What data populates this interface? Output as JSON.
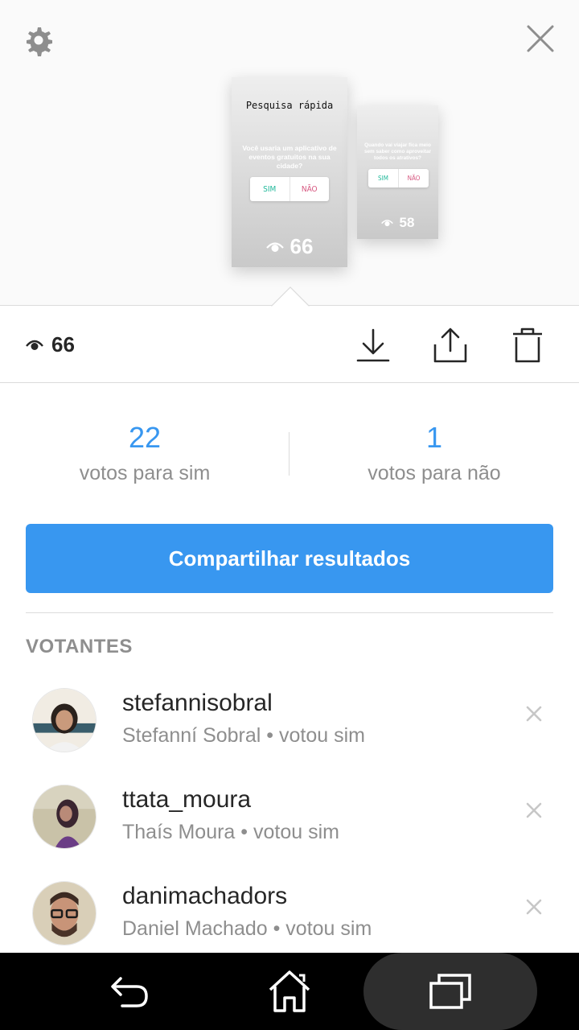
{
  "preview": {
    "settings_icon": "gear-icon",
    "close_icon": "close-icon",
    "stories": [
      {
        "title": "Pesquisa rápida",
        "question": "Você usaria um aplicativo de eventos gratuitos na sua cidade?",
        "option_yes": "SIM",
        "option_no": "NÃO",
        "views": "66"
      },
      {
        "title": "",
        "question": "Quando vai viajar fica meio sem saber como aproveitar todos os atrativos?",
        "option_yes": "SIM",
        "option_no": "NÃO",
        "views": "58"
      }
    ]
  },
  "toolbar": {
    "views": "66",
    "download_icon": "download-icon",
    "share_icon": "share-icon",
    "delete_icon": "trash-icon"
  },
  "stats": {
    "yes_count": "22",
    "yes_label": "votos para sim",
    "no_count": "1",
    "no_label": "votos para não"
  },
  "share_button": "Compartilhar resultados",
  "voters_title": "VOTANTES",
  "voters": [
    {
      "username": "stefannisobral",
      "subtitle": "Stefanní Sobral • votou sim"
    },
    {
      "username": "ttata_moura",
      "subtitle": "Thaís Moura • votou sim"
    },
    {
      "username": "danimachadors",
      "subtitle": "Daniel Machado • votou sim"
    }
  ],
  "colors": {
    "accent": "#3897f0",
    "yes": "#1fb89a",
    "no": "#d6567f"
  }
}
